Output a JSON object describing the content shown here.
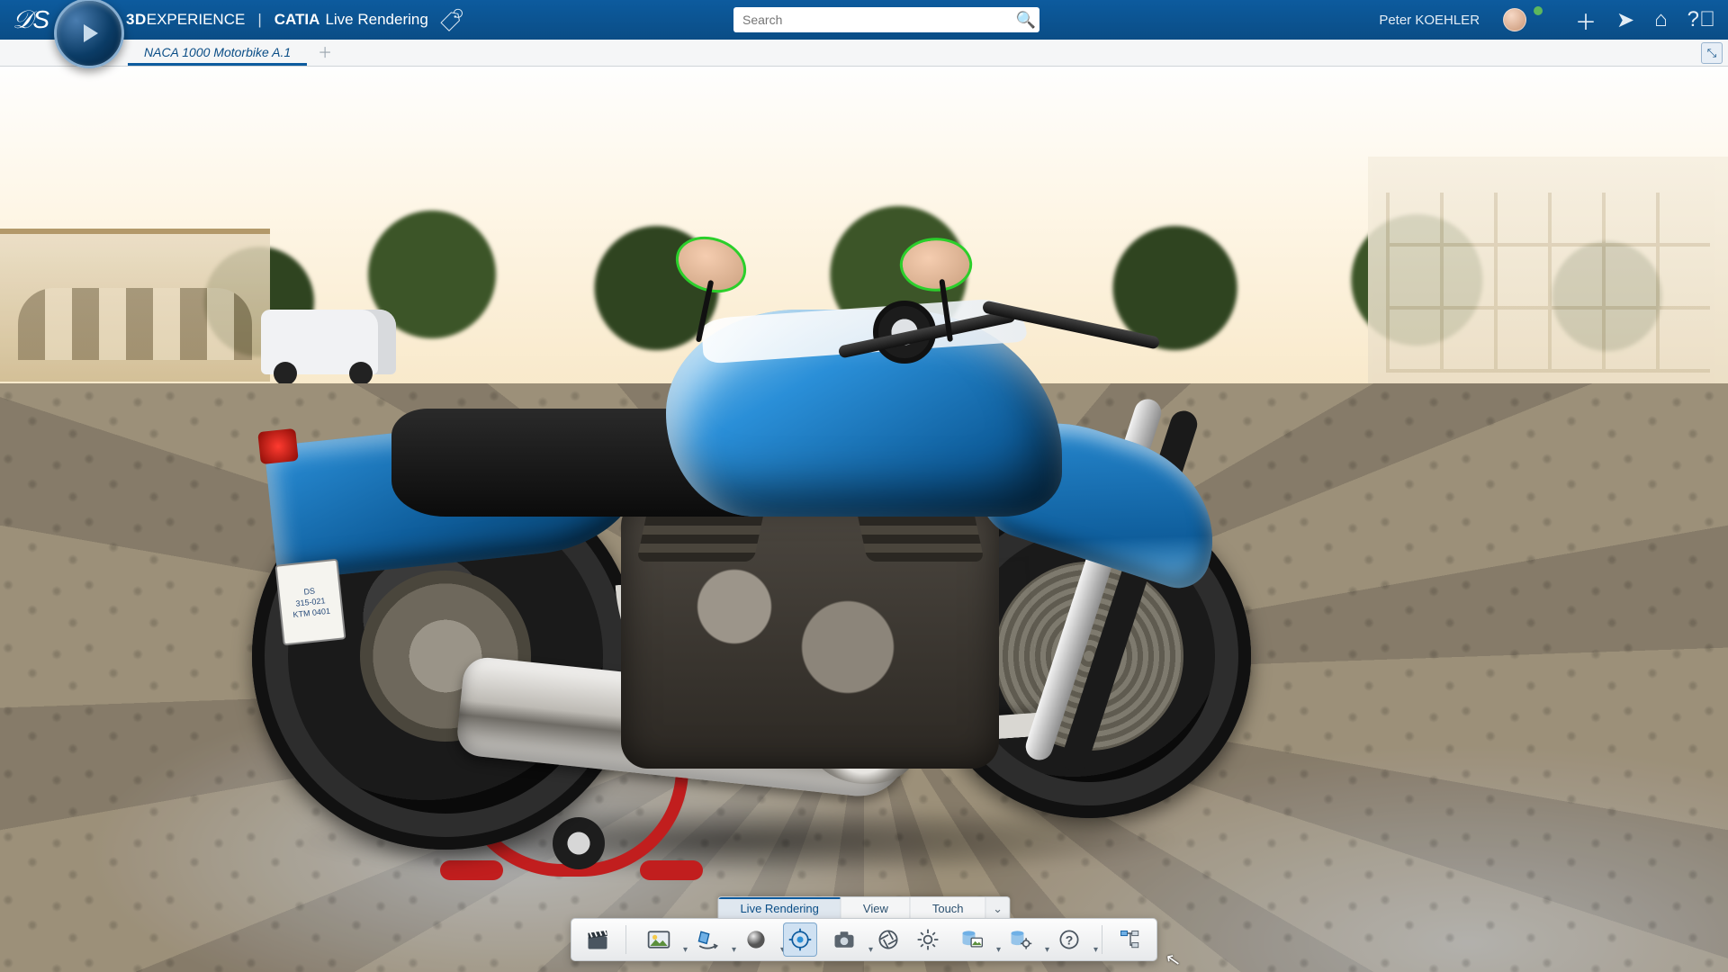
{
  "header": {
    "brand_prefix": "3D",
    "brand_main": "EXPERIENCE",
    "brand_suite": "CATIA",
    "brand_module": "Live Rendering",
    "search_placeholder": "Search",
    "user_name": "Peter KOEHLER"
  },
  "tabs": {
    "items": [
      {
        "label": "NACA 1000 Motorbike A.1",
        "active": true
      }
    ]
  },
  "action_tabs": {
    "items": [
      {
        "label": "Live Rendering",
        "active": true
      },
      {
        "label": "View",
        "active": false
      },
      {
        "label": "Touch",
        "active": false
      }
    ]
  },
  "toolbar": {
    "tools": [
      {
        "name": "scenes-tool",
        "icon": "clapper",
        "dropdown": false,
        "active": false
      },
      {
        "name": "environment-tool",
        "icon": "picture",
        "dropdown": true,
        "active": false
      },
      {
        "name": "turntable-tool",
        "icon": "rotate3d",
        "dropdown": true,
        "active": false
      },
      {
        "name": "material-tool",
        "icon": "sphere",
        "dropdown": true,
        "active": false
      },
      {
        "name": "render-tool",
        "icon": "raycircle",
        "dropdown": false,
        "active": true
      },
      {
        "name": "snapshot-tool",
        "icon": "camera",
        "dropdown": true,
        "active": false
      },
      {
        "name": "quality-tool",
        "icon": "aperture",
        "dropdown": false,
        "active": false
      },
      {
        "name": "settings-tool",
        "icon": "gear",
        "dropdown": false,
        "active": false
      },
      {
        "name": "library-tool",
        "icon": "dbpic",
        "dropdown": true,
        "active": false
      },
      {
        "name": "sync-tool",
        "icon": "dbgear",
        "dropdown": true,
        "active": false
      },
      {
        "name": "help-tool",
        "icon": "help",
        "dropdown": true,
        "active": false
      },
      {
        "name": "tree-tool",
        "icon": "tree",
        "dropdown": false,
        "active": false
      }
    ]
  },
  "colors": {
    "brand_blue": "#0d5b9e",
    "accent_blue": "#2a8fd8",
    "selection_green": "#2bcf2b",
    "stand_red": "#c11e1e"
  },
  "scene": {
    "model": "NACA 1000 Motorbike",
    "selected_parts": [
      "mirror-left",
      "mirror-right"
    ],
    "environment": "Mediterranean plaza (cobblestone, trees, buildings)",
    "license_plate_lines": [
      "DS",
      "315-021",
      "KTM 0401"
    ]
  }
}
